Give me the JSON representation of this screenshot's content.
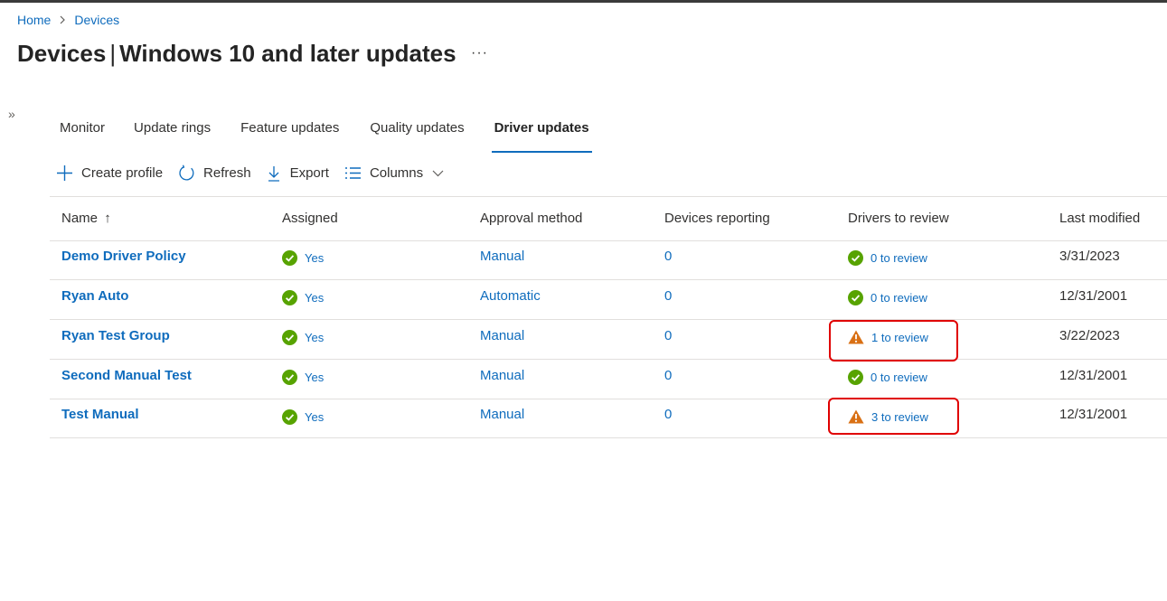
{
  "breadcrumb": {
    "home": "Home",
    "devices": "Devices"
  },
  "title": {
    "main": "Devices",
    "separator": "|",
    "sub": "Windows 10 and later updates",
    "more": "···"
  },
  "sidebar": {
    "expand": "»"
  },
  "tabs": [
    "Monitor",
    "Update rings",
    "Feature updates",
    "Quality updates",
    "Driver updates"
  ],
  "active_tab": "Driver updates",
  "toolbar": {
    "create_profile": "Create profile",
    "refresh": "Refresh",
    "export": "Export",
    "columns": "Columns"
  },
  "table": {
    "headers": {
      "name": "Name",
      "name_sort": "↑",
      "assigned": "Assigned",
      "approval": "Approval method",
      "devices": "Devices reporting",
      "drivers": "Drivers to review",
      "modified": "Last modified"
    },
    "rows": [
      {
        "name": "Demo Driver Policy",
        "assigned": "Yes",
        "approval": "Manual",
        "devices": "0",
        "drivers": "0 to review",
        "drivers_status": "ok",
        "modified": "3/31/2023"
      },
      {
        "name": "Ryan Auto",
        "assigned": "Yes",
        "approval": "Automatic",
        "devices": "0",
        "drivers": "0 to review",
        "drivers_status": "ok",
        "modified": "12/31/2001"
      },
      {
        "name": "Ryan Test Group",
        "assigned": "Yes",
        "approval": "Manual",
        "devices": "0",
        "drivers": "1 to review",
        "drivers_status": "warning",
        "modified": "3/22/2023"
      },
      {
        "name": "Second Manual Test",
        "assigned": "Yes",
        "approval": "Manual",
        "devices": "0",
        "drivers": "0 to review",
        "drivers_status": "ok",
        "modified": "12/31/2001"
      },
      {
        "name": "Test Manual",
        "assigned": "Yes",
        "approval": "Manual",
        "devices": "0",
        "drivers": "3 to review",
        "drivers_status": "warning",
        "modified": "12/31/2001"
      }
    ]
  },
  "colors": {
    "accent": "#0f6cbd",
    "success": "#57a300",
    "warning": "#d97014",
    "highlight": "#e00000"
  },
  "icons": {
    "assigned": "check-circle-icon",
    "ok": "check-circle-icon",
    "warning": "warning-triangle-icon"
  }
}
